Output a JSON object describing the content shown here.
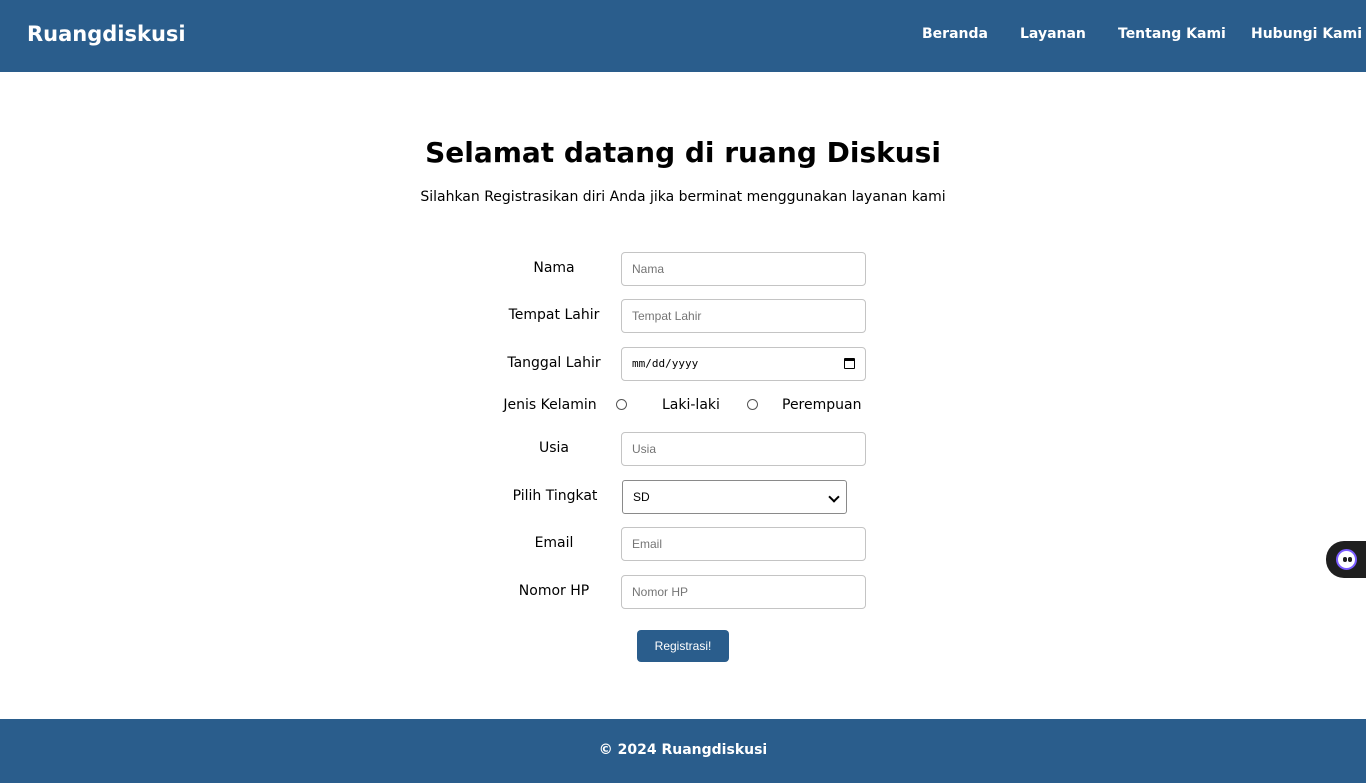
{
  "navbar": {
    "brand": "Ruangdiskusi",
    "links": [
      "Beranda",
      "Layanan",
      "Tentang Kami",
      "Hubungi Kami"
    ]
  },
  "hero": {
    "title": "Selamat datang di ruang Diskusi",
    "subtitle": "Silahkan Registrasikan diri Anda jika berminat menggunakan layanan kami"
  },
  "form": {
    "nama": {
      "label": "Nama",
      "placeholder": "Nama"
    },
    "tempat_lahir": {
      "label": "Tempat Lahir",
      "placeholder": "Tempat Lahir"
    },
    "tanggal_lahir": {
      "label": "Tanggal Lahir",
      "placeholder": "mm/dd/yyyy"
    },
    "jenis_kelamin": {
      "label": "Jenis Kelamin",
      "options": [
        "Laki-laki",
        "Perempuan"
      ]
    },
    "usia": {
      "label": "Usia",
      "placeholder": "Usia"
    },
    "tingkat": {
      "label": "Pilih Tingkat",
      "selected": "SD"
    },
    "email": {
      "label": "Email",
      "placeholder": "Email"
    },
    "nomor_hp": {
      "label": "Nomor HP",
      "placeholder": "Nomor HP"
    },
    "submit_label": "Registrasi!"
  },
  "footer": {
    "text": "© 2024 Ruangdiskusi"
  },
  "colors": {
    "primary": "#2a5d8c",
    "widget_accent": "#7b5cff"
  },
  "widget": {
    "icon": "assistant-face-icon"
  }
}
